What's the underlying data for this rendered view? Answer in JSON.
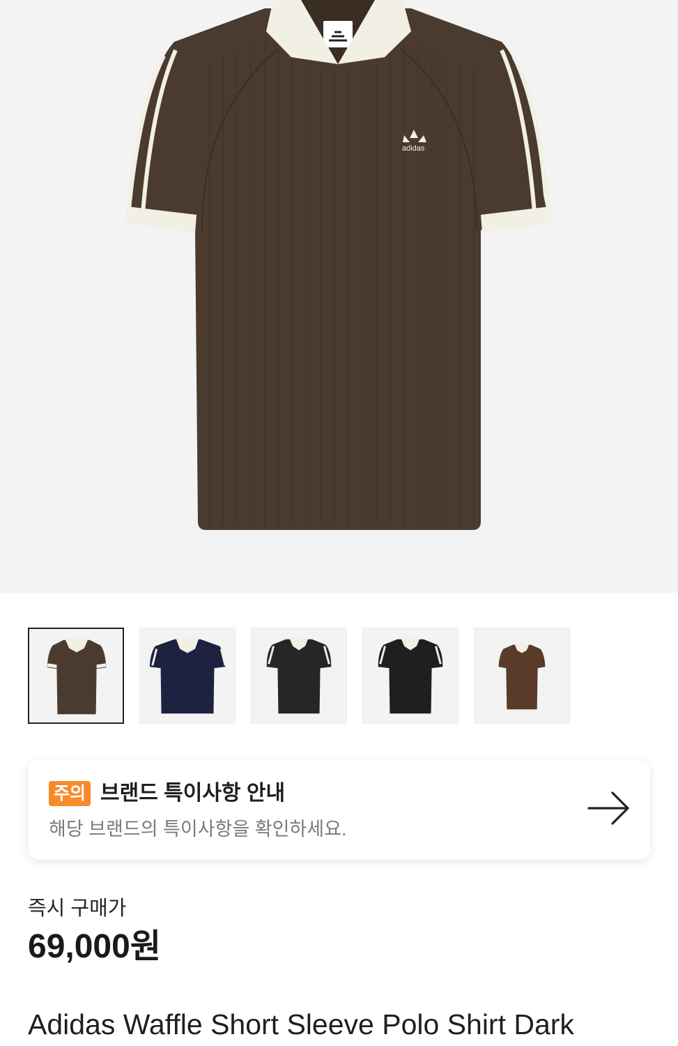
{
  "hero": {
    "brand_mark": "adidas",
    "shirt_color": "#4a3b2e"
  },
  "thumbnails": [
    {
      "shirt_color": "#4a3b2e",
      "selected": true
    },
    {
      "shirt_color": "#1c2240",
      "selected": false
    },
    {
      "shirt_color": "#262626",
      "selected": false
    },
    {
      "shirt_color": "#1f1f1f",
      "selected": false
    },
    {
      "shirt_color": "#5a3a28",
      "selected": false
    }
  ],
  "notice": {
    "badge": "주의",
    "title": "브랜드 특이사항 안내",
    "subtitle": "해당 브랜드의 특이사항을 확인하세요.",
    "icon": "arrow-right-icon"
  },
  "price": {
    "label": "즉시 구매가",
    "value": "69,000원"
  },
  "product": {
    "title": "Adidas Waffle Short Sleeve Polo Shirt Dark"
  },
  "colors": {
    "badge": "#f78a2b",
    "hero_bg": "#f3f3f3",
    "collar": "#f2efe4"
  }
}
